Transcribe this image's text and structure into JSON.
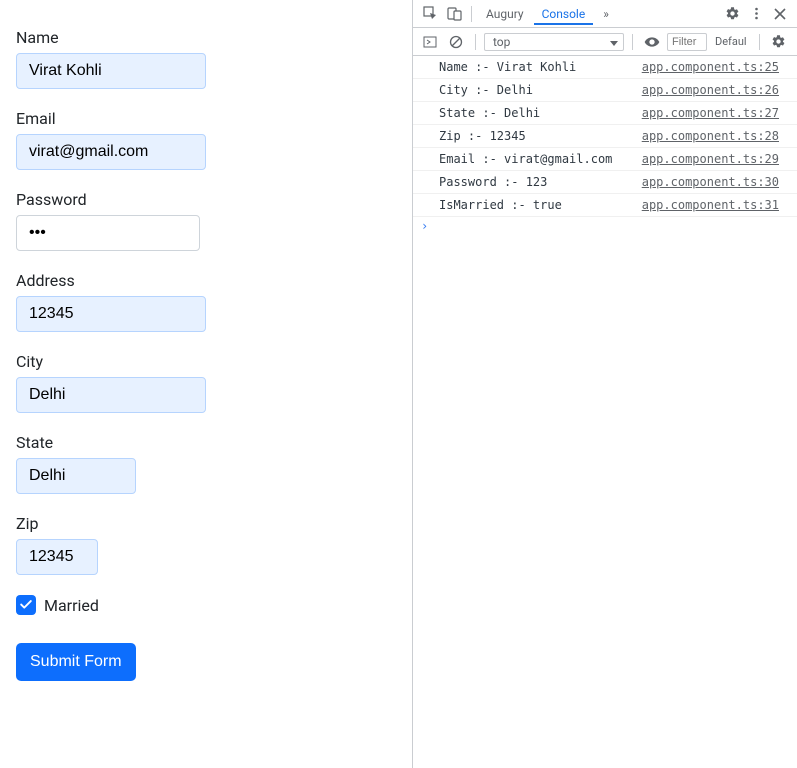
{
  "form": {
    "name": {
      "label": "Name",
      "value": "Virat Kohli"
    },
    "email": {
      "label": "Email",
      "value": "virat@gmail.com"
    },
    "password": {
      "label": "Password",
      "value": "•••"
    },
    "address": {
      "label": "Address",
      "value": "12345"
    },
    "city": {
      "label": "City",
      "value": "Delhi"
    },
    "state": {
      "label": "State",
      "value": "Delhi"
    },
    "zip": {
      "label": "Zip",
      "value": "12345"
    },
    "married": {
      "label": "Married",
      "checked": true
    },
    "submit_label": "Submit Form"
  },
  "devtools": {
    "tabs": {
      "augury": "Augury",
      "console": "Console",
      "more": "»"
    },
    "toolbar": {
      "context": "top",
      "filter_placeholder": "Filter",
      "level": "Defaul"
    },
    "logs": [
      {
        "msg": "Name :- Virat Kohli",
        "src": "app.component.ts:25"
      },
      {
        "msg": "City :- Delhi",
        "src": "app.component.ts:26"
      },
      {
        "msg": "State :- Delhi",
        "src": "app.component.ts:27"
      },
      {
        "msg": "Zip :- 12345",
        "src": "app.component.ts:28"
      },
      {
        "msg": "Email :- virat@gmail.com",
        "src": "app.component.ts:29"
      },
      {
        "msg": "Password :- 123",
        "src": "app.component.ts:30"
      },
      {
        "msg": "IsMarried :- true",
        "src": "app.component.ts:31"
      }
    ],
    "prompt": "›"
  }
}
